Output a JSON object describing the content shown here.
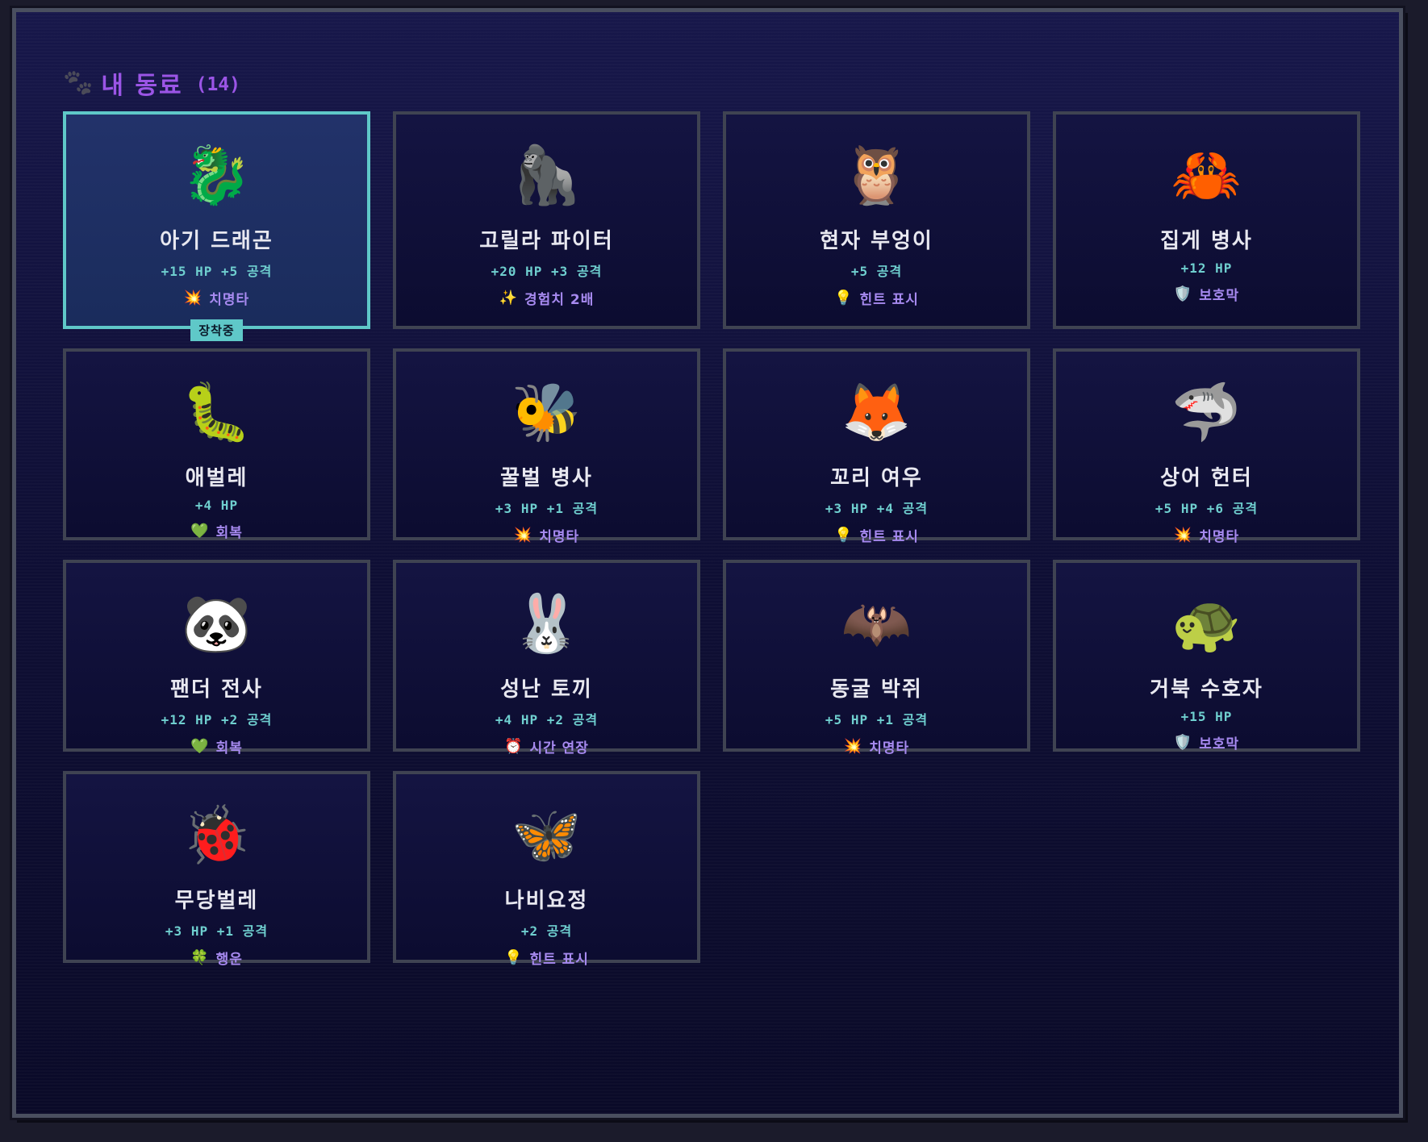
{
  "header": {
    "paw_icon": "🐾",
    "title": "내 동료",
    "count": "(14)"
  },
  "companions": [
    {
      "icon": "🐉",
      "name": "아기 드래곤",
      "stats": "+15 HP +5 공격",
      "skill_icon": "💥",
      "skill": "치명타",
      "badge": "장착중",
      "selected": true
    },
    {
      "icon": "🦍",
      "name": "고릴라 파이터",
      "stats": "+20 HP +3 공격",
      "skill_icon": "✨",
      "skill": "경험치 2배"
    },
    {
      "icon": "🦉",
      "name": "현자 부엉이",
      "stats": "+5 공격",
      "skill_icon": "💡",
      "skill": "힌트 표시"
    },
    {
      "icon": "🦀",
      "name": "집게 병사",
      "stats": "+12 HP",
      "skill_icon": "🛡️",
      "skill": "보호막"
    },
    {
      "icon": "🐛",
      "name": "애벌레",
      "stats": "+4 HP",
      "skill_icon": "💚",
      "skill": "회복"
    },
    {
      "icon": "🐝",
      "name": "꿀벌 병사",
      "stats": "+3 HP +1 공격",
      "skill_icon": "💥",
      "skill": "치명타"
    },
    {
      "icon": "🦊",
      "name": "꼬리 여우",
      "stats": "+3 HP +4 공격",
      "skill_icon": "💡",
      "skill": "힌트 표시"
    },
    {
      "icon": "🦈",
      "name": "상어 헌터",
      "stats": "+5 HP +6 공격",
      "skill_icon": "💥",
      "skill": "치명타"
    },
    {
      "icon": "🐼",
      "name": "팬더 전사",
      "stats": "+12 HP +2 공격",
      "skill_icon": "💚",
      "skill": "회복"
    },
    {
      "icon": "🐰",
      "name": "성난 토끼",
      "stats": "+4 HP +2 공격",
      "skill_icon": "⏰",
      "skill": "시간 연장"
    },
    {
      "icon": "🦇",
      "name": "동굴 박쥐",
      "stats": "+5 HP +1 공격",
      "skill_icon": "💥",
      "skill": "치명타"
    },
    {
      "icon": "🐢",
      "name": "거북 수호자",
      "stats": "+15 HP",
      "skill_icon": "🛡️",
      "skill": "보호막"
    },
    {
      "icon": "🐞",
      "name": "무당벌레",
      "stats": "+3 HP +1 공격",
      "skill_icon": "🍀",
      "skill": "행운"
    },
    {
      "icon": "🦋",
      "name": "나비요정",
      "stats": "+2 공격",
      "skill_icon": "💡",
      "skill": "힌트 표시"
    }
  ],
  "colors": {
    "accent": "#9b55e6",
    "stat": "#6fcfcf",
    "skill": "#a78af0",
    "selected_border": "#5fc8c8"
  }
}
